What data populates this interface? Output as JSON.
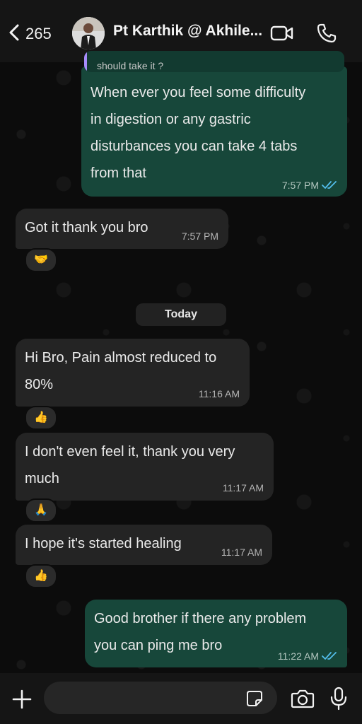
{
  "header": {
    "back_count": "265",
    "contact_name": "Pt Karthik @ Akhile..."
  },
  "messages": [
    {
      "id": "m1",
      "direction": "out",
      "quoted_text": "should take it ?",
      "lines": [
        "When ever you feel some difficulty",
        "in digestion or any gastric",
        "disturbances you can take 4 tabs",
        "from that"
      ],
      "time": "7:57 PM",
      "status": "read"
    },
    {
      "id": "m2",
      "direction": "in",
      "lines": [
        "Got it thank you bro"
      ],
      "time": "7:57 PM",
      "reaction": "🤝"
    },
    {
      "id": "m3",
      "direction": "in",
      "lines": [
        "Hi Bro, Pain almost reduced to",
        "80%"
      ],
      "time": "11:16 AM",
      "reaction": "👍"
    },
    {
      "id": "m4",
      "direction": "in",
      "lines": [
        "I don't even feel it, thank you very",
        "much"
      ],
      "time": "11:17 AM",
      "reaction": "🙏"
    },
    {
      "id": "m5",
      "direction": "in",
      "lines": [
        "I hope it's started healing"
      ],
      "time": "11:17 AM",
      "reaction": "👍"
    },
    {
      "id": "m6",
      "direction": "out",
      "lines": [
        "Good brother if there any problem",
        "you can ping me bro"
      ],
      "time": "11:22 AM",
      "status": "read"
    }
  ],
  "date_separator": "Today",
  "composer": {
    "value": "",
    "placeholder": ""
  },
  "icons": {
    "back": "chevron-left-icon",
    "video": "video-call-icon",
    "phone": "phone-icon",
    "attach": "plus-icon",
    "sticker": "sticker-icon",
    "camera": "camera-icon",
    "mic": "microphone-icon",
    "read_tick": "double-check-icon"
  },
  "colors": {
    "outgoing_bubble": "#17473a",
    "incoming_bubble": "#242424",
    "read_tick": "#53bdeb",
    "header_bg": "#151515"
  }
}
